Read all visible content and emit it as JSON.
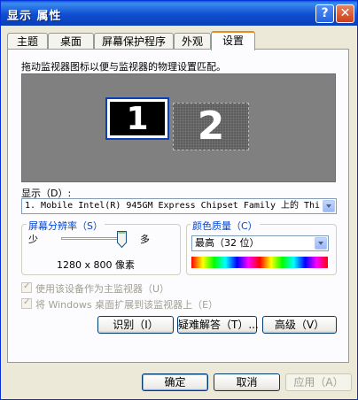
{
  "window": {
    "title": "显示 属性",
    "help_glyph": "?",
    "close_glyph": "✕"
  },
  "tabs": [
    {
      "label": "主题"
    },
    {
      "label": "桌面"
    },
    {
      "label": "屏幕保护程序"
    },
    {
      "label": "外观"
    },
    {
      "label": "设置",
      "active": true
    }
  ],
  "instruction": "拖动监视器图标以便与监视器的物理设置匹配。",
  "monitors": {
    "primary": "1",
    "secondary": "2"
  },
  "display": {
    "label": "显示（D）:",
    "value": "1. Mobile Intel(R) 945GM Express Chipset Family 上的 Thi"
  },
  "resolution": {
    "legend": "屏幕分辨率（S）",
    "low": "少",
    "high": "多",
    "value": "1280 x 800 像素"
  },
  "color_quality": {
    "legend": "颜色质量（C）",
    "value": "最高（32 位）"
  },
  "checkboxes": [
    {
      "label": "使用该设备作为主监视器（U）",
      "checked": true,
      "enabled": false
    },
    {
      "label": "将 Windows 桌面扩展到该监视器上（E）",
      "checked": true,
      "enabled": false
    }
  ],
  "action_buttons": {
    "identify": "识别（I）",
    "troubleshoot": "疑难解答（T）...",
    "advanced": "高级（V）"
  },
  "dialog_buttons": {
    "ok": "确定",
    "cancel": "取消",
    "apply": "应用（A）"
  },
  "colors": {
    "title_blue": "#0a3fb8",
    "tab_accent": "#e68b2c",
    "legend_blue": "#0046d5"
  }
}
